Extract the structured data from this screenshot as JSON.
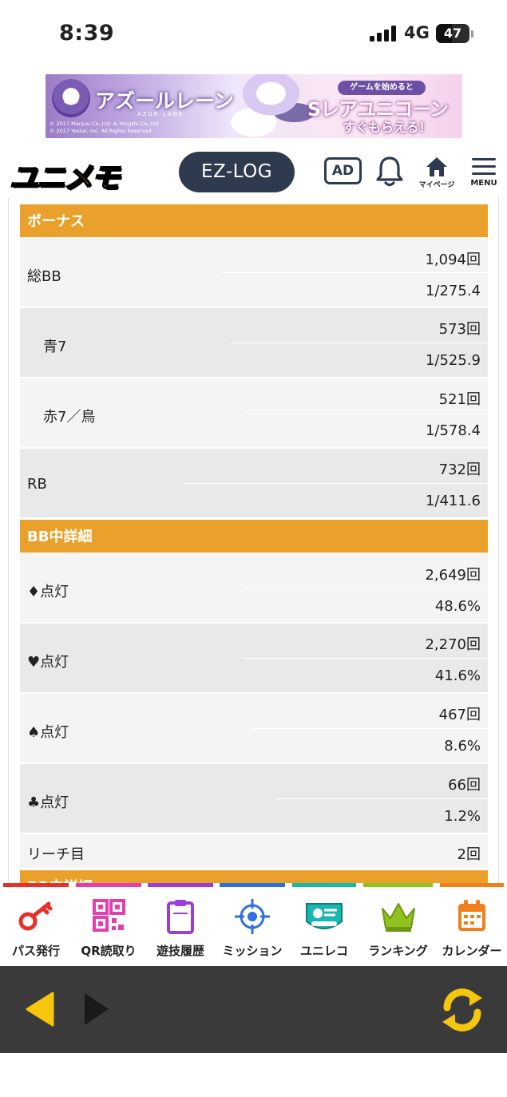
{
  "status": {
    "time": "8:39",
    "network": "4G",
    "battery": "47",
    "battery_level": 0.47
  },
  "banner": {
    "logo": "アズールレーン",
    "sublogo": "AZUR LANE",
    "copyright_1": "© 2017 Manjuu Co.,Ltd. & Yongshi Co.,Ltd.",
    "copyright_2": "© 2017 Yostar, Inc. All Rights Reserved.",
    "pill": "ゲームを始めると",
    "title": "Sレアユニコーン",
    "sub": "すぐもらえる！"
  },
  "header": {
    "logo": "ユニメモ",
    "ezlog": "EZ-LOG",
    "ad": "AD",
    "home_label": "マイページ",
    "menu_label": "MENU"
  },
  "sections": [
    {
      "title": "ボーナス",
      "rows": [
        {
          "label": "総BB",
          "count": "1,094回",
          "rate": "1/275.4"
        },
        {
          "label": "青7",
          "count": "573回",
          "rate": "1/525.9"
        },
        {
          "label": "赤7／鳥",
          "count": "521回",
          "rate": "1/578.4"
        },
        {
          "label": "RB",
          "count": "732回",
          "rate": "1/411.6"
        }
      ]
    },
    {
      "title": "BB中詳細",
      "rows": [
        {
          "label": "♦点灯",
          "count": "2,649回",
          "rate": "48.6%"
        },
        {
          "label": "♥点灯",
          "count": "2,270回",
          "rate": "41.6%"
        },
        {
          "label": "♠点灯",
          "count": "467回",
          "rate": "8.6%"
        },
        {
          "label": "♣点灯",
          "count": "66回",
          "rate": "1.2%"
        }
      ],
      "reach": {
        "label": "リーチ目",
        "count": "2回"
      }
    },
    {
      "title": "RB中詳細"
    }
  ],
  "toolbar": [
    {
      "label": "パス発行",
      "icon": "key-icon",
      "color": "#e8302b"
    },
    {
      "label": "QR読取り",
      "icon": "qr-code-icon",
      "color": "#e23fb0"
    },
    {
      "label": "遊技履歴",
      "icon": "clipboard-icon",
      "color": "#9a3fd6"
    },
    {
      "label": "ミッション",
      "icon": "target-icon",
      "color": "#2f6fe0"
    },
    {
      "label": "ユニレコ",
      "icon": "unireco-icon",
      "color": "#1ab6b0"
    },
    {
      "label": "ランキング",
      "icon": "crown-icon",
      "color": "#8fc21f"
    },
    {
      "label": "カレンダー",
      "icon": "calendar-icon",
      "color": "#f0801e"
    }
  ],
  "colors": {
    "section": "#e9a12b",
    "nav_bg": "#3a3a3a",
    "nav_accent": "#f5c60c",
    "header_dark": "#2e3a4d"
  }
}
